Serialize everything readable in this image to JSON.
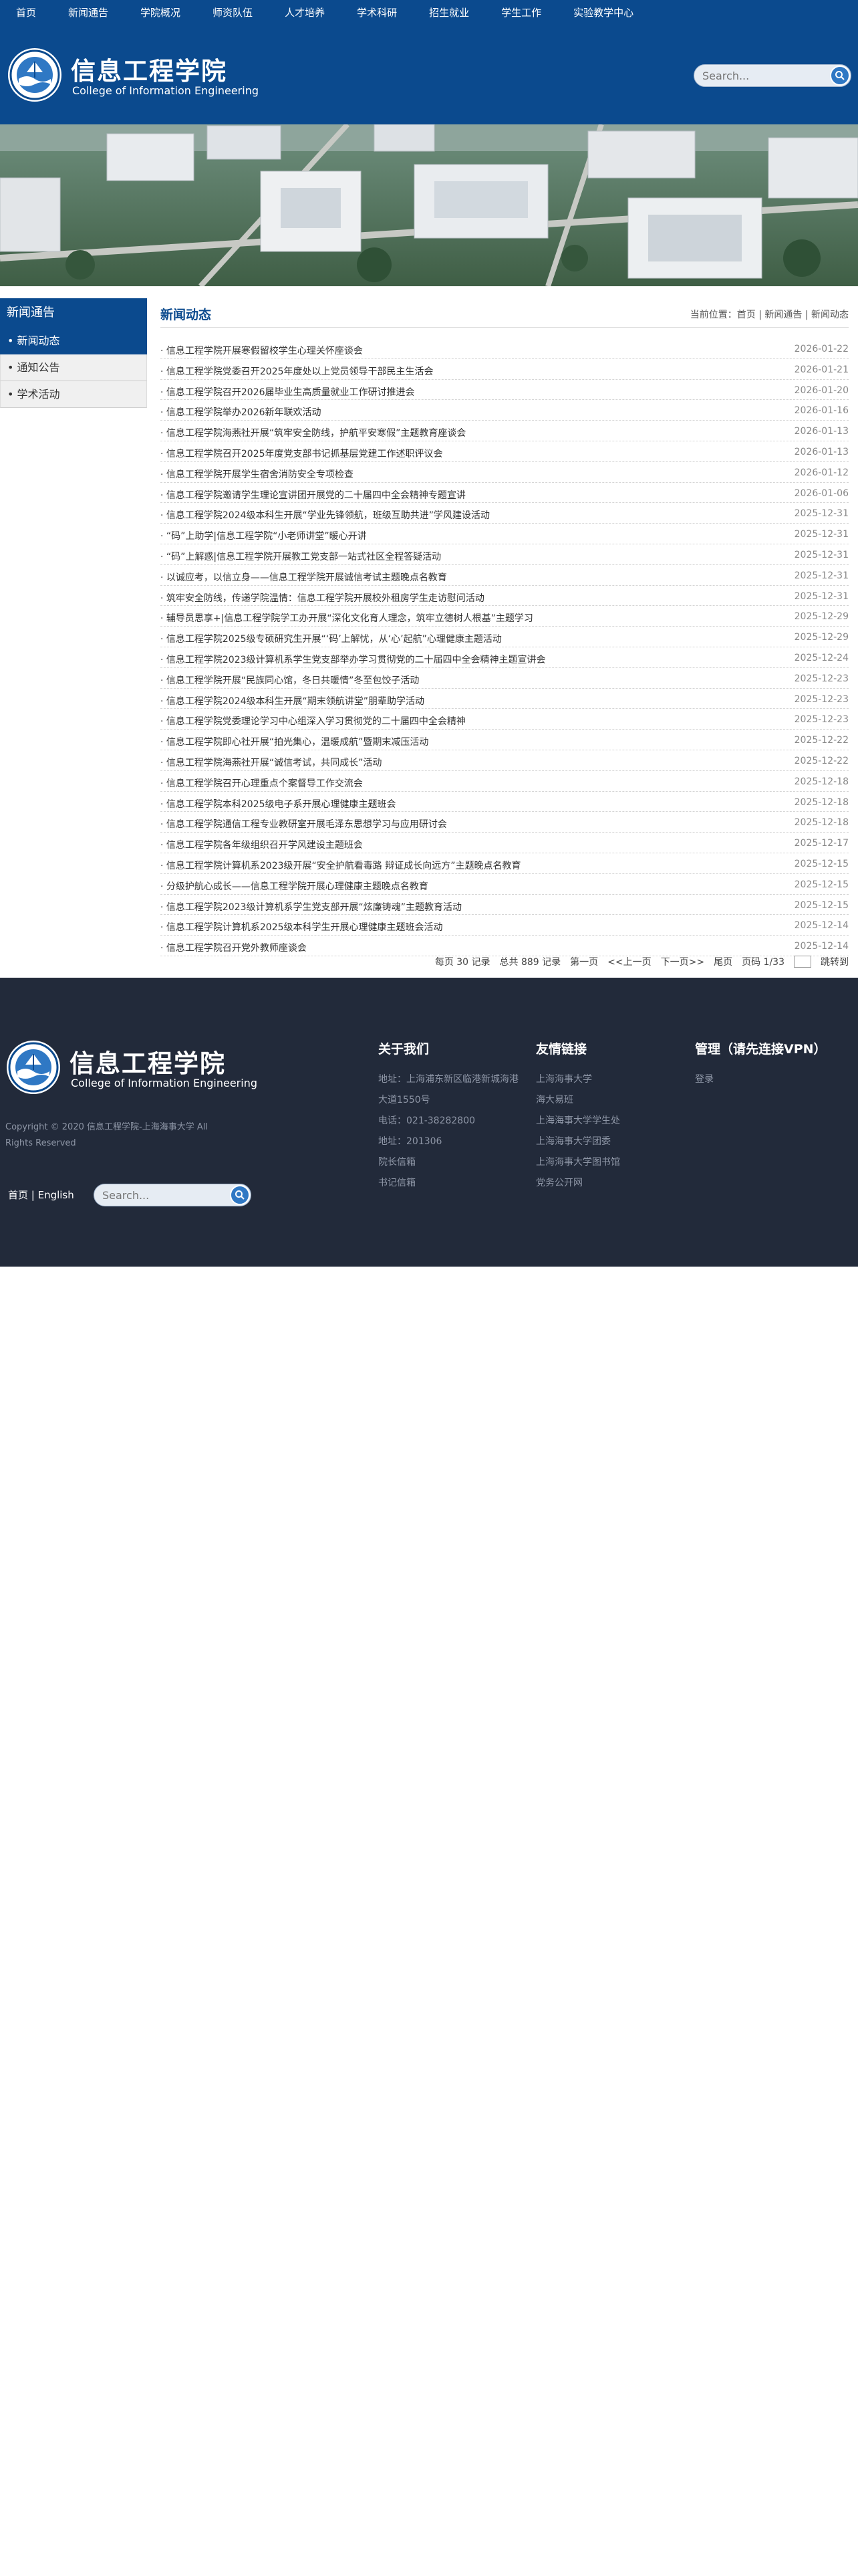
{
  "topnav": [
    "首页",
    "新闻通告",
    "学院概况",
    "师资队伍",
    "人才培养",
    "学术科研",
    "招生就业",
    "学生工作",
    "实验教学中心"
  ],
  "brand": {
    "cn": "信息工程学院",
    "en": "College of Information Engineering"
  },
  "search": {
    "placeholder": "Search..."
  },
  "sidebar": {
    "title": "新闻通告",
    "items": [
      {
        "label": "新闻动态",
        "active": true
      },
      {
        "label": "通知公告",
        "active": false
      },
      {
        "label": "学术活动",
        "active": false
      }
    ]
  },
  "main": {
    "title": "新闻动态",
    "breadcrumb": "当前位置：首页 | 新闻通告 | 新闻动态",
    "news": [
      {
        "title": "信息工程学院开展寒假留校学生心理关怀座谈会",
        "date": "2026-01-22"
      },
      {
        "title": "信息工程学院党委召开2025年度处以上党员领导干部民主生活会",
        "date": "2026-01-21"
      },
      {
        "title": "信息工程学院召开2026届毕业生高质量就业工作研讨推进会",
        "date": "2026-01-20"
      },
      {
        "title": "信息工程学院举办2026新年联欢活动",
        "date": "2026-01-16"
      },
      {
        "title": "信息工程学院海燕社开展“筑牢安全防线，护航平安寒假”主题教育座谈会",
        "date": "2026-01-13"
      },
      {
        "title": "信息工程学院召开2025年度党支部书记抓基层党建工作述职评议会",
        "date": "2026-01-13"
      },
      {
        "title": "信息工程学院开展学生宿舍消防安全专项检查",
        "date": "2026-01-12"
      },
      {
        "title": "信息工程学院邀请学生理论宣讲团开展党的二十届四中全会精神专题宣讲",
        "date": "2026-01-06"
      },
      {
        "title": "信息工程学院2024级本科生开展“学业先锋领航，班级互助共进”学风建设活动",
        "date": "2025-12-31"
      },
      {
        "title": "“码”上助学|信息工程学院“小老师讲堂”暖心开讲",
        "date": "2025-12-31"
      },
      {
        "title": "“码”上解惑|信息工程学院开展教工党支部一站式社区全程答疑活动",
        "date": "2025-12-31"
      },
      {
        "title": "以诚应考，以信立身——信息工程学院开展诚信考试主题晚点名教育",
        "date": "2025-12-31"
      },
      {
        "title": "筑牢安全防线，传递学院温情：信息工程学院开展校外租房学生走访慰问活动",
        "date": "2025-12-31"
      },
      {
        "title": "辅导员思享+|信息工程学院学工办开展“深化文化育人理念，筑牢立德树人根基”主题学习",
        "date": "2025-12-29"
      },
      {
        "title": "信息工程学院2025级专硕研究生开展“‘码’上解忧，从‘心’起航”心理健康主题活动",
        "date": "2025-12-29"
      },
      {
        "title": "信息工程学院2023级计算机系学生党支部举办学习贯彻党的二十届四中全会精神主题宣讲会",
        "date": "2025-12-24"
      },
      {
        "title": "信息工程学院开展“民族同心馆，冬日共暖情”冬至包饺子活动",
        "date": "2025-12-23"
      },
      {
        "title": "信息工程学院2024级本科生开展“期末领航讲堂”朋辈助学活动",
        "date": "2025-12-23"
      },
      {
        "title": "信息工程学院党委理论学习中心组深入学习贯彻党的二十届四中全会精神",
        "date": "2025-12-23"
      },
      {
        "title": "信息工程学院即心社开展“拍光集心，温暖成航”暨期末减压活动",
        "date": "2025-12-22"
      },
      {
        "title": "信息工程学院海燕社开展“诚信考试，共同成长”活动",
        "date": "2025-12-22"
      },
      {
        "title": "信息工程学院召开心理重点个案督导工作交流会",
        "date": "2025-12-18"
      },
      {
        "title": "信息工程学院本科2025级电子系开展心理健康主题班会",
        "date": "2025-12-18"
      },
      {
        "title": "信息工程学院通信工程专业教研室开展毛泽东思想学习与应用研讨会",
        "date": "2025-12-18"
      },
      {
        "title": "信息工程学院各年级组织召开学风建设主题班会",
        "date": "2025-12-17"
      },
      {
        "title": "信息工程学院计算机系2023级开展“安全护航看毒路 辩证成长向远方”主题晚点名教育",
        "date": "2025-12-15"
      },
      {
        "title": "分级护航心成长——信息工程学院开展心理健康主题晚点名教育",
        "date": "2025-12-15"
      },
      {
        "title": "信息工程学院2023级计算机系学生党支部开展“炫廉铸魂”主题教育活动",
        "date": "2025-12-15"
      },
      {
        "title": "信息工程学院计算机系2025级本科学生开展心理健康主题班会活动",
        "date": "2025-12-14"
      },
      {
        "title": "信息工程学院召开党外教师座谈会",
        "date": "2025-12-14"
      }
    ],
    "pager": {
      "per_page": "每页 30 记录",
      "total": "总共 889 记录",
      "first": "第一页",
      "prev": "<<上一页",
      "next": "下一页>>",
      "last": "尾页",
      "page": "页码 1/33",
      "go": "跳转到"
    }
  },
  "footer": {
    "copyright": "Copyright © 2020 信息工程学院-上海海事大学 All Rights Reserved",
    "lang": "首页 | English",
    "about": {
      "title": "关于我们",
      "lines": [
        "地址：上海浦东新区临港新城海港",
        "大道1550号",
        "电话：021-38282800",
        "地址：201306",
        "院长信箱",
        "书记信箱"
      ]
    },
    "links": {
      "title": "友情链接",
      "lines": [
        "上海海事大学",
        "海大易班",
        "上海海事大学学生处",
        "上海海事大学团委",
        "上海海事大学图书馆",
        "党务公开网"
      ]
    },
    "manage": {
      "title": "管理（请先连接VPN）",
      "lines": [
        "登录"
      ]
    }
  },
  "colors": {
    "brand_blue": "#0b4a8e",
    "footer_bg": "#222a3a",
    "accent": "#2f78c4"
  }
}
